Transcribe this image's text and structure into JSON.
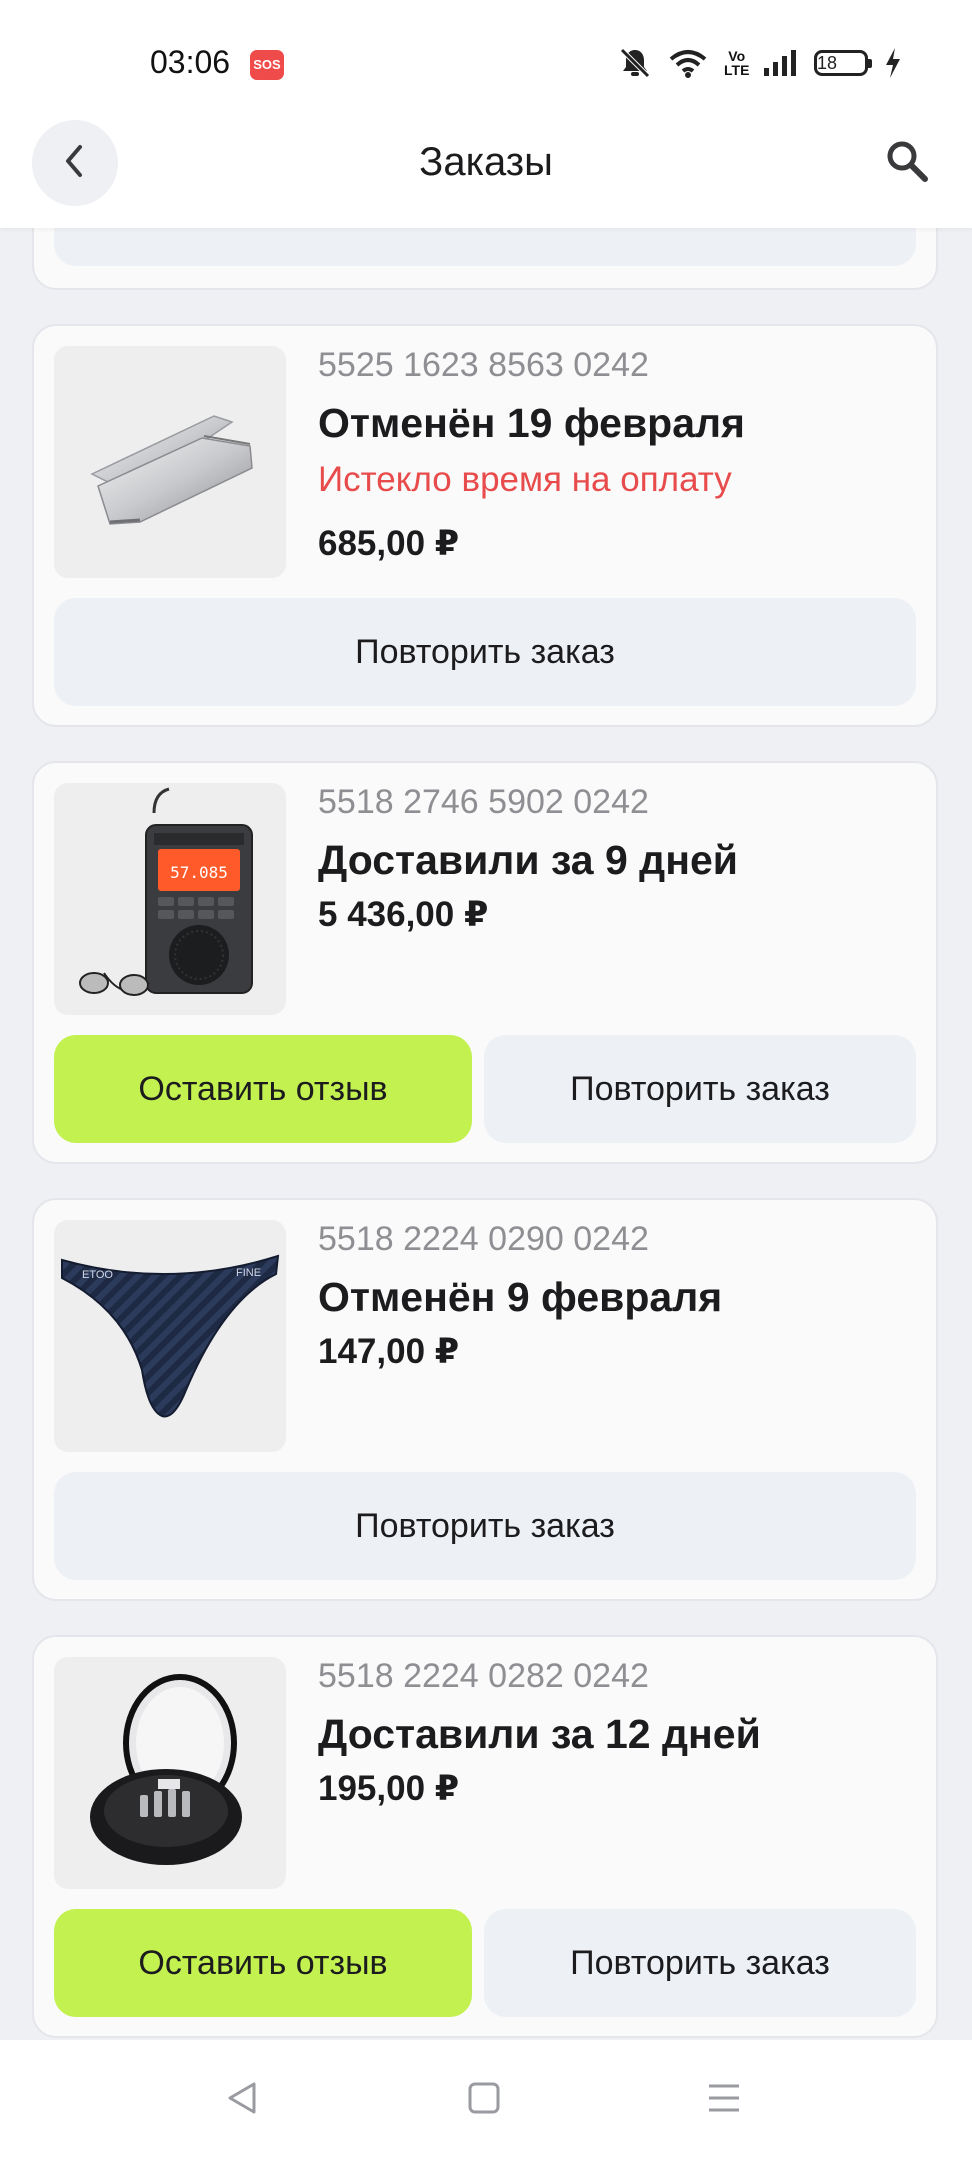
{
  "status_bar": {
    "time": "03:06",
    "sos": "SOS",
    "network_label": "Vo LTE",
    "battery": "18"
  },
  "header": {
    "title": "Заказы",
    "back_icon": "chevron-left-icon",
    "search_icon": "search-icon"
  },
  "orders": [
    {
      "number": "5525 1623 8563 0242",
      "status": "Отменён 19 февраля",
      "note": "Истекло время на оплату",
      "price": "685,00 ₽",
      "image": "folding-knife",
      "repeat_label": "Повторить заказ"
    },
    {
      "number": "5518 2746 5902 0242",
      "status": "Доставили за 9 дней",
      "price": "5 436,00 ₽",
      "image": "portable-radio",
      "review_label": "Оставить отзыв",
      "repeat_label": "Повторить заказ"
    },
    {
      "number": "5518 2224 0290 0242",
      "status": "Отменён 9 февраля",
      "price": "147,00 ₽",
      "image": "underwear",
      "repeat_label": "Повторить заказ"
    },
    {
      "number": "5518 2224 0282 0242",
      "status": "Доставили за 12 дней",
      "price": "195,00 ₽",
      "image": "cable-adapter-kit",
      "review_label": "Оставить отзыв",
      "repeat_label": "Повторить заказ"
    }
  ],
  "colors": {
    "accent_review": "#c2f150",
    "error_text": "#e84b4b",
    "background": "#eef0f4",
    "button_secondary": "#edf0f5"
  },
  "system_nav": {
    "back_icon": "triangle-back-icon",
    "home_icon": "square-home-icon",
    "menu_icon": "menu-lines-icon"
  }
}
